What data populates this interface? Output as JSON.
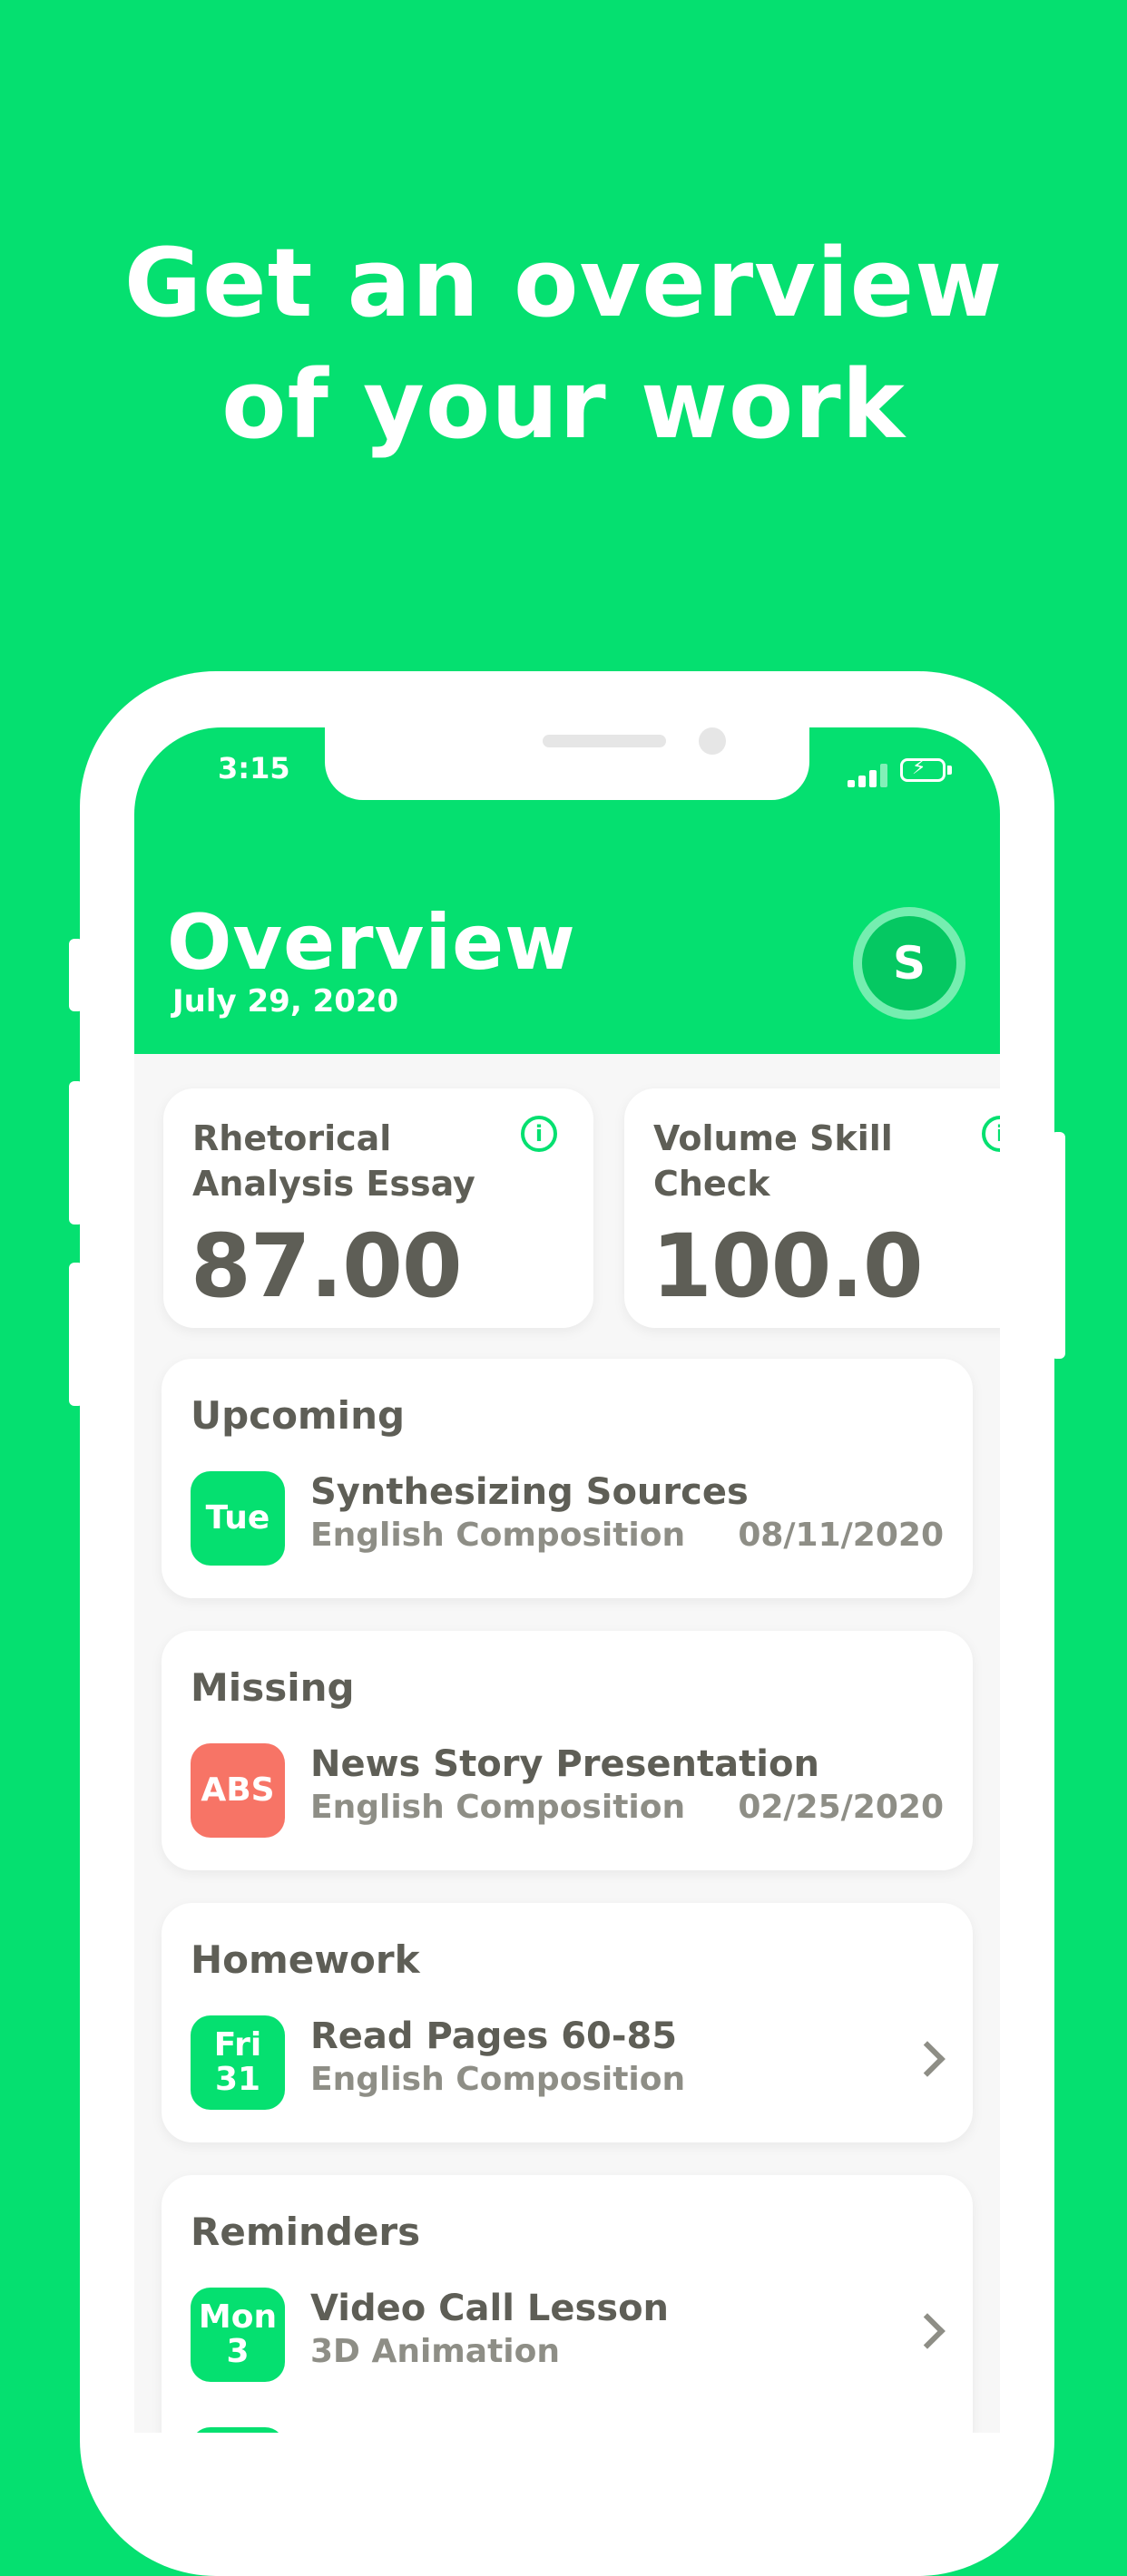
{
  "headline": {
    "line1": "Get an overview",
    "line2": "of your work"
  },
  "status_bar": {
    "time": "3:15",
    "signal_icon": "signal-icon",
    "battery_icon": "battery-charging-icon"
  },
  "header": {
    "title": "Overview",
    "date": "July 29, 2020",
    "avatar_initial": "S"
  },
  "grades": [
    {
      "name": "Rhetorical Analysis Essay",
      "value": "87.00",
      "icon": "info-icon"
    },
    {
      "name": "Volume Skill Check",
      "value": "100.0",
      "icon": "info-icon"
    }
  ],
  "sections": {
    "upcoming": {
      "title": "Upcoming",
      "badge": "Tue",
      "item_title": "Synthesizing Sources",
      "item_sub": "English Composition",
      "item_date": "08/11/2020"
    },
    "missing": {
      "title": "Missing",
      "badge": "ABS",
      "item_title": "News Story Presentation",
      "item_sub": "English Composition",
      "item_date": "02/25/2020"
    },
    "homework": {
      "title": "Homework",
      "badge_day": "Fri",
      "badge_num": "31",
      "item_title": "Read Pages 60-85",
      "item_sub": "English Composition"
    },
    "reminders": {
      "title": "Reminders",
      "badge_day": "Mon",
      "badge_num": "3",
      "item_title": "Video Call Lesson",
      "item_sub": "3D Animation"
    }
  },
  "colors": {
    "brand_green": "#05E070",
    "missing_red": "#F77466",
    "text_dark": "#5E5E56",
    "text_muted": "#8E8E86"
  }
}
